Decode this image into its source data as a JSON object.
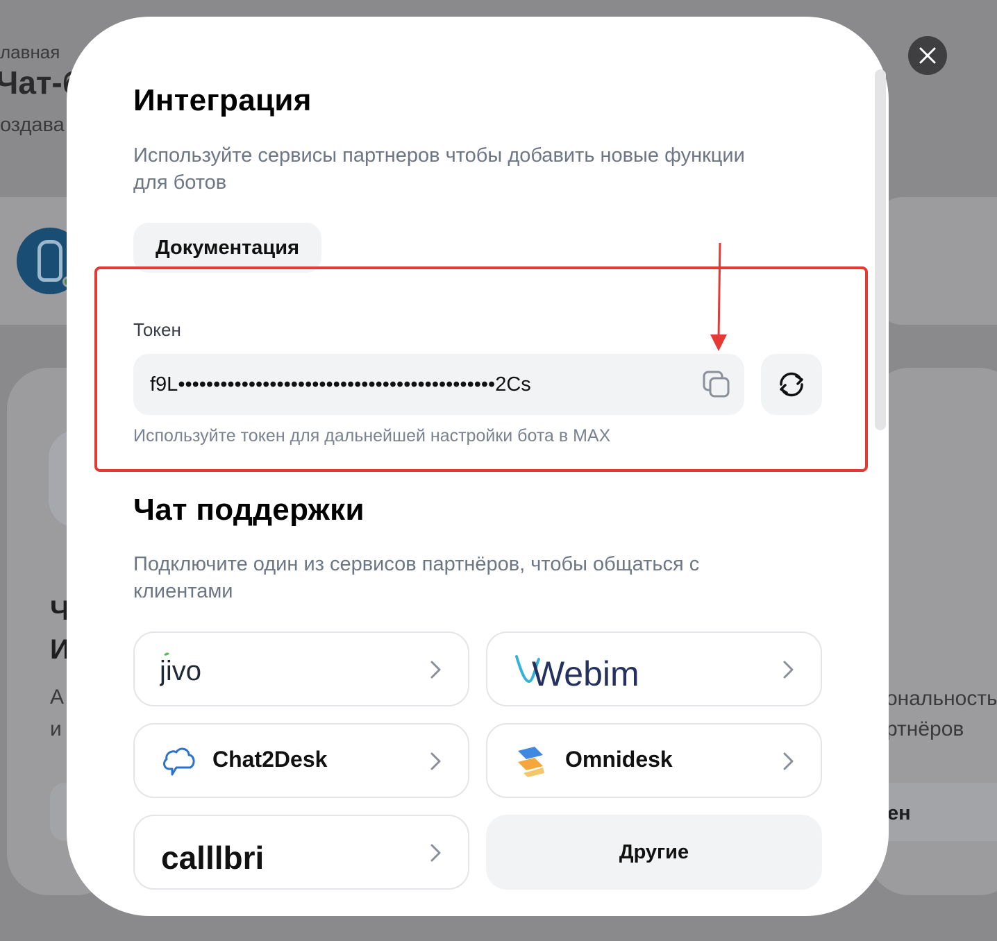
{
  "background": {
    "breadcrumb": "лавная",
    "title_fragment": "Чат-б",
    "subtitle_fragment": "оздава",
    "left_lines": [
      "Ч",
      "И",
      "А",
      "и"
    ],
    "right_lines": [
      "ональносты",
      "ртнёров",
      "ен"
    ]
  },
  "modal": {
    "close_icon": "close-icon",
    "integration": {
      "title": "Интеграция",
      "subtitle": "Используйте сервисы партнеров чтобы добавить новые функции для ботов",
      "docs_button": "Документация"
    },
    "token": {
      "label": "Токен",
      "value": "f9L•••••••••••••••••••••••••••••••••••••••••••••2Cs",
      "hint": "Используйте токен для дальнейшей настройки бота в MAX",
      "copy_icon": "copy-icon",
      "refresh_icon": "refresh-icon"
    },
    "support": {
      "title": "Чат поддержки",
      "subtitle": "Подключите один из сервисов партнёров, чтобы общаться с клиентами",
      "services": [
        {
          "name": "jivo"
        },
        {
          "name": "Webim"
        },
        {
          "name": "Chat2Desk"
        },
        {
          "name": "Omnidesk"
        },
        {
          "name": "calllbri"
        }
      ],
      "others_button": "Другие"
    }
  },
  "colors": {
    "annotation": "#e53935",
    "muted_text": "#6c7684",
    "field_bg": "#f2f3f5"
  }
}
